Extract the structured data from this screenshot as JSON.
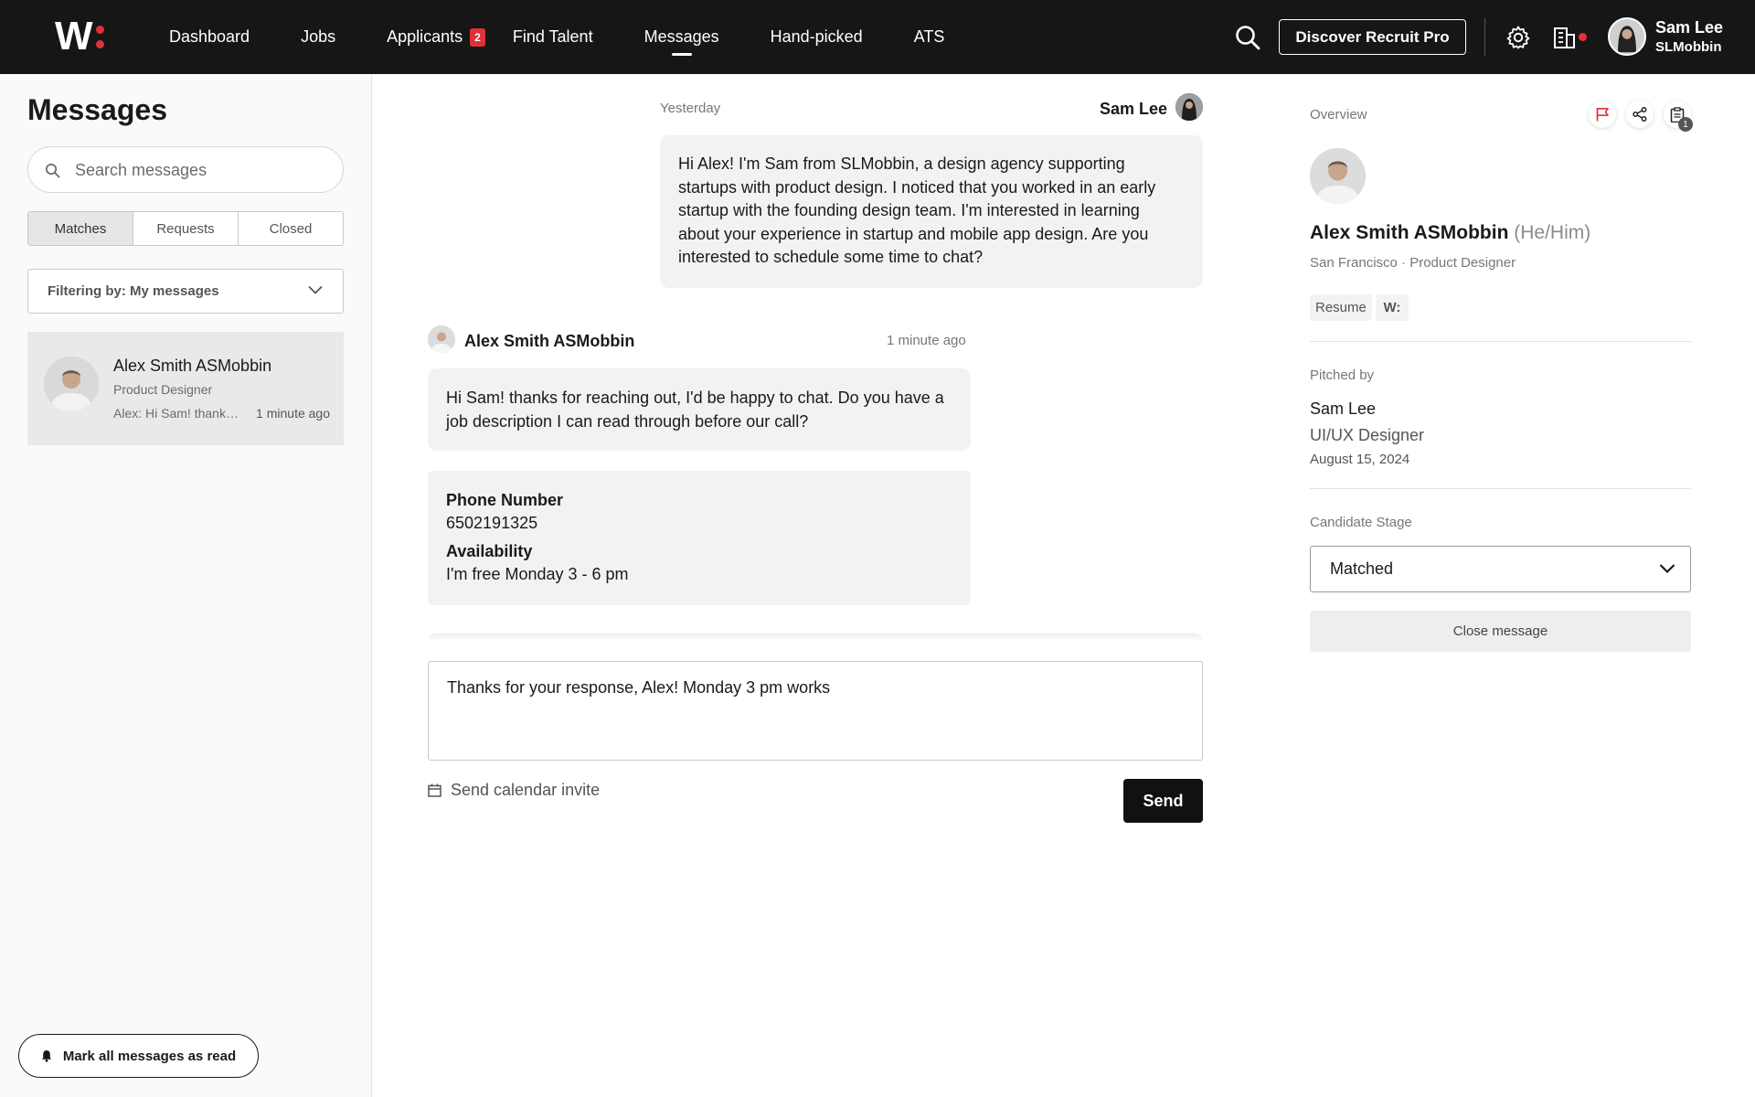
{
  "nav": {
    "logo_text": "W",
    "items": [
      {
        "label": "Dashboard"
      },
      {
        "label": "Jobs"
      },
      {
        "label": "Applicants",
        "badge": "2"
      },
      {
        "label": "Find Talent"
      },
      {
        "label": "Messages",
        "active": true
      },
      {
        "label": "Hand-picked"
      },
      {
        "label": "ATS"
      }
    ],
    "discover_label": "Discover Recruit Pro",
    "user_name": "Sam Lee",
    "user_org": "SLMobbin",
    "icons": [
      "search-icon",
      "gear-icon",
      "building-icon",
      "avatar"
    ],
    "accent_color": "#e0313a"
  },
  "sidebar": {
    "title": "Messages",
    "search_placeholder": "Search messages",
    "tabs": [
      "Matches",
      "Requests",
      "Closed"
    ],
    "active_tab": "Matches",
    "filter_label": "Filtering by: My messages",
    "conversations": [
      {
        "name": "Alex Smith ASMobbin",
        "title": "Product Designer",
        "preview": "Alex: Hi Sam! thanks for reaching out, I'd be happy to chat.",
        "time": "1 minute ago"
      }
    ],
    "mark_read_label": "Mark all messages as read"
  },
  "thread": {
    "day_label": "Yesterday",
    "outgoing": {
      "sender": "Sam Lee",
      "text": "Hi Alex! I'm Sam from SLMobbin, a design agency supporting startups with product design. I noticed that you worked in an early startup with the founding design team. I'm interested in learning about your experience in startup and mobile app design. Are you interested to schedule some time to chat?"
    },
    "incoming": {
      "sender": "Alex Smith ASMobbin",
      "time": "1 minute ago",
      "text": "Hi Sam! thanks for reaching out, I'd be happy to chat. Do you have a job description I can read through before our call?"
    },
    "info_card": {
      "phone_label": "Phone Number",
      "phone_value": "6502191325",
      "availability_label": "Availability",
      "availability_value": "I'm free Monday 3 - 6 pm"
    },
    "compose_value": "Thanks for your response, Alex! Monday 3 pm works",
    "calendar_invite_label": "Send calendar invite",
    "send_label": "Send"
  },
  "overview": {
    "label": "Overview",
    "notes_count": "1",
    "candidate_name": "Alex Smith ASMobbin",
    "pronouns": "(He/Him)",
    "location_role": "San Francisco · Product Designer",
    "resume_label": "Resume",
    "w_tag": "W:",
    "pitched_by_label": "Pitched by",
    "pitched_by_name": "Sam Lee",
    "pitched_by_role": "UI/UX Designer",
    "pitched_date": "August 15, 2024",
    "stage_label": "Candidate Stage",
    "stage_value": "Matched",
    "close_label": "Close message"
  }
}
